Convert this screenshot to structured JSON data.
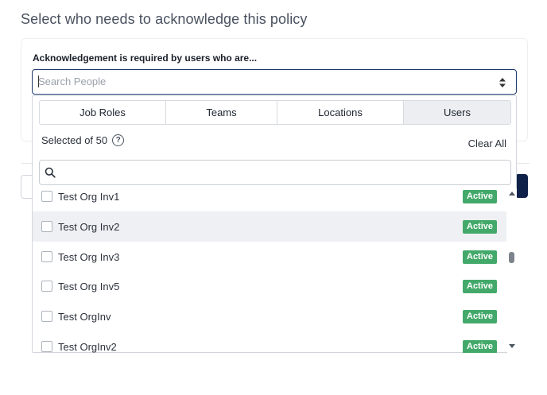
{
  "page_title": "Select who needs to acknowledge this policy",
  "field_label": "Acknowledgement is required by users who are...",
  "search": {
    "placeholder": "Search People",
    "value": ""
  },
  "tabs": [
    {
      "label": "Job Roles",
      "active": false
    },
    {
      "label": "Teams",
      "active": false
    },
    {
      "label": "Locations",
      "active": false
    },
    {
      "label": "Users",
      "active": true
    }
  ],
  "selection": {
    "count_text": "Selected of 50",
    "help_icon": "question-circle-icon",
    "clear_label": "Clear All"
  },
  "inner_search": {
    "placeholder": "",
    "value": ""
  },
  "users": [
    {
      "name": "Test Org Inv1",
      "status": "Active",
      "checked": false
    },
    {
      "name": "Test Org Inv2",
      "status": "Active",
      "checked": false,
      "hovered": true
    },
    {
      "name": "Test Org Inv3",
      "status": "Active",
      "checked": false
    },
    {
      "name": "Test Org Inv5",
      "status": "Active",
      "checked": false
    },
    {
      "name": "Test OrgInv",
      "status": "Active",
      "checked": false
    },
    {
      "name": "Test OrgInv2",
      "status": "Active",
      "checked": false
    }
  ],
  "colors": {
    "accent": "#1e3a6d",
    "active_badge": "#43a96a",
    "primary_button": "#0f2148"
  }
}
